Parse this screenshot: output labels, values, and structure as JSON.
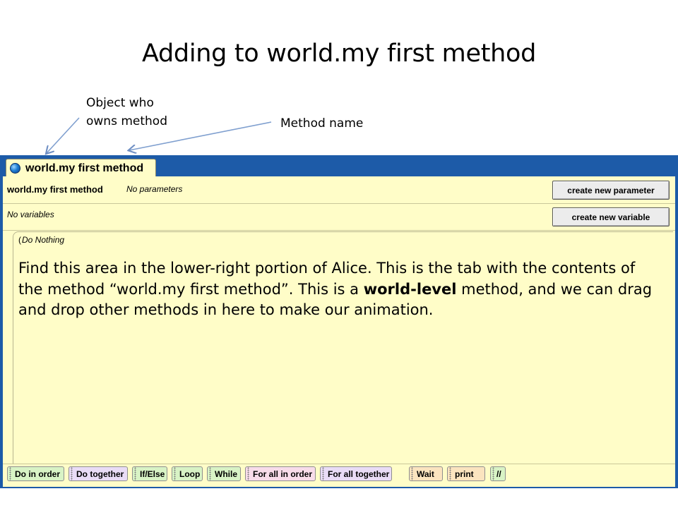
{
  "slide": {
    "title": "Adding to world.my first method",
    "callouts": {
      "owner_line1": "Object who",
      "owner_line2": "owns method",
      "method_name": "Method name"
    },
    "explanation": {
      "part1": "Find this area in the lower-right portion of Alice. This is the tab with the contents of the method “world.my first method”. This is a ",
      "bold": "world-level",
      "part2": " method, and we can drag and drop other methods in here to make our animation."
    }
  },
  "editor": {
    "tab_label": "world.my first method",
    "tab_icon": "globe-icon",
    "method_name": "world.my first method",
    "parameters_text": "No parameters",
    "variables_text": "No variables",
    "create_parameter_label": "create new parameter",
    "create_variable_label": "create new variable",
    "body_placeholder": "Do Nothing"
  },
  "toolbar": {
    "items": [
      {
        "label": "Do in order",
        "color": "green"
      },
      {
        "label": "Do together",
        "color": "purple"
      },
      {
        "label": "If/Else",
        "color": "green"
      },
      {
        "label": "Loop",
        "color": "green"
      },
      {
        "label": "While",
        "color": "green"
      },
      {
        "label": "For all in order",
        "color": "pink"
      },
      {
        "label": "For all together",
        "color": "purple"
      },
      {
        "label": "Wait",
        "color": "orange"
      },
      {
        "label": "print",
        "color": "orange"
      },
      {
        "label": "//",
        "color": "green"
      }
    ]
  },
  "colors": {
    "editor_frame": "#1d5ba8",
    "panel_background": "#fffdc8",
    "arrow": "#7f9fcf"
  }
}
